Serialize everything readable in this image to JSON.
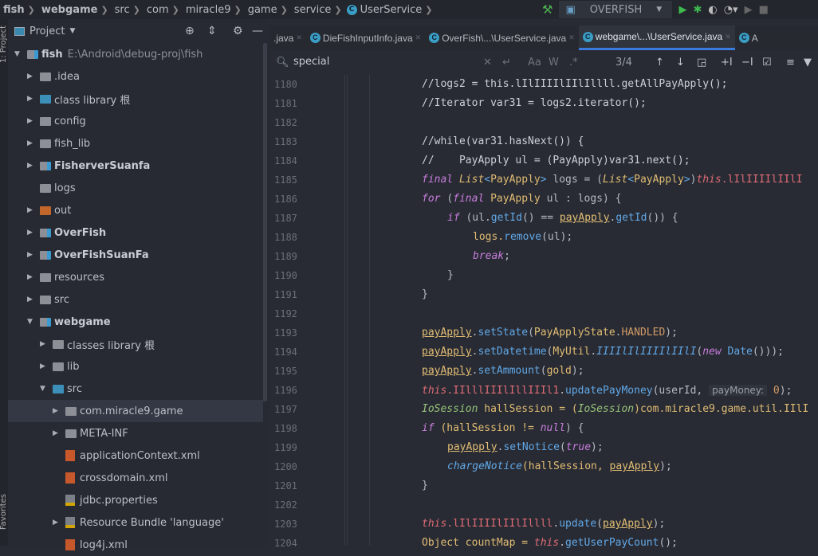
{
  "breadcrumb": [
    "fish",
    "webgame",
    "src",
    "com",
    "miracle9",
    "game",
    "service",
    "UserService"
  ],
  "run_config": "OVERFISH",
  "project": {
    "title": "Project",
    "tool_window_label": "1: Project",
    "favorites_label": "Favorites",
    "tree": [
      {
        "label": "fish",
        "hint": "E:\\Android\\debug-proj\\fish",
        "bold": true,
        "level": 0,
        "arrow": "down",
        "icon": "module"
      },
      {
        "label": ".idea",
        "level": 1,
        "arrow": "right",
        "icon": "folder"
      },
      {
        "label": "class library 根",
        "level": 1,
        "arrow": "right",
        "icon": "folder-blue"
      },
      {
        "label": "config",
        "level": 1,
        "arrow": "right",
        "icon": "folder"
      },
      {
        "label": "fish_lib",
        "level": 1,
        "arrow": "right",
        "icon": "folder"
      },
      {
        "label": "FisherverSuanfa",
        "bold": true,
        "level": 1,
        "arrow": "right",
        "icon": "module"
      },
      {
        "label": "logs",
        "level": 1,
        "arrow": "",
        "icon": "folder"
      },
      {
        "label": "out",
        "level": 1,
        "arrow": "right",
        "icon": "folder-orange"
      },
      {
        "label": "OverFish",
        "bold": true,
        "level": 1,
        "arrow": "right",
        "icon": "module"
      },
      {
        "label": "OverFishSuanFa",
        "bold": true,
        "level": 1,
        "arrow": "right",
        "icon": "module"
      },
      {
        "label": "resources",
        "level": 1,
        "arrow": "right",
        "icon": "folder"
      },
      {
        "label": "src",
        "level": 1,
        "arrow": "right",
        "icon": "folder"
      },
      {
        "label": "webgame",
        "bold": true,
        "level": 1,
        "arrow": "down",
        "icon": "module"
      },
      {
        "label": "classes library 根",
        "level": 2,
        "arrow": "right",
        "icon": "folder"
      },
      {
        "label": "lib",
        "level": 2,
        "arrow": "right",
        "icon": "folder"
      },
      {
        "label": "src",
        "level": 2,
        "arrow": "down",
        "icon": "folder-blue"
      },
      {
        "label": "com.miracle9.game",
        "level": 3,
        "arrow": "right",
        "icon": "package",
        "selected": true
      },
      {
        "label": "META-INF",
        "level": 3,
        "arrow": "right",
        "icon": "folder"
      },
      {
        "label": "applicationContext.xml",
        "level": 3,
        "arrow": "",
        "icon": "xml"
      },
      {
        "label": "crossdomain.xml",
        "level": 3,
        "arrow": "",
        "icon": "xml"
      },
      {
        "label": "jdbc.properties",
        "level": 3,
        "arrow": "",
        "icon": "properties"
      },
      {
        "label": "Resource Bundle 'language'",
        "level": 3,
        "arrow": "right",
        "icon": "properties"
      },
      {
        "label": "log4j.xml",
        "level": 3,
        "arrow": "",
        "icon": "xml"
      }
    ]
  },
  "tabs": [
    {
      "label": ".java",
      "active": false
    },
    {
      "label": "DieFishInputInfo.java",
      "active": false
    },
    {
      "label": "OverFish\\...\\UserService.java",
      "active": false
    },
    {
      "label": "webgame\\...\\UserService.java",
      "active": true
    },
    {
      "label": "A",
      "active": false
    }
  ],
  "search": {
    "query": "special",
    "match_count": "3/4",
    "buttons": [
      "Aa",
      "W",
      ".*"
    ]
  },
  "code": [
    {
      "n": "1180",
      "indent": 0,
      "seg": [
        [
          "//logs2 = this.lIlIIIIlIIlIllll.getAllPayApply();",
          "c"
        ]
      ]
    },
    {
      "n": "1181",
      "indent": 0,
      "seg": [
        [
          "//Iterator var31 = logs2.iterator();",
          "c"
        ]
      ]
    },
    {
      "n": "1182",
      "indent": 0,
      "seg": []
    },
    {
      "n": "1183",
      "indent": 0,
      "seg": [
        [
          "//while(var31.hasNext()) {",
          "c"
        ]
      ]
    },
    {
      "n": "1184",
      "indent": 0,
      "seg": [
        [
          "//    PayApply ul = (PayApply)var31.next();",
          "c"
        ]
      ]
    },
    {
      "n": "1185",
      "indent": 0,
      "seg": [
        [
          "final ",
          "k"
        ],
        [
          "List",
          "t i"
        ],
        [
          "<",
          "m"
        ],
        [
          "PayApply",
          "t"
        ],
        [
          "> ",
          "m"
        ],
        [
          "logs = (",
          "p"
        ],
        [
          "List",
          "t i"
        ],
        [
          "<",
          "m"
        ],
        [
          "PayApply",
          "t"
        ],
        [
          ">",
          "m"
        ],
        [
          ")",
          "p"
        ],
        [
          "this",
          "f i"
        ],
        [
          ".lIlIIIIlIIlI",
          "f"
        ]
      ]
    },
    {
      "n": "1186",
      "indent": 0,
      "seg": [
        [
          "for ",
          "k"
        ],
        [
          "(",
          "p"
        ],
        [
          "final ",
          "k"
        ],
        [
          "PayApply ",
          "t"
        ],
        [
          "ul : logs) {",
          "p"
        ]
      ]
    },
    {
      "n": "1187",
      "indent": 1,
      "seg": [
        [
          "if ",
          "k"
        ],
        [
          "(ul.",
          "p"
        ],
        [
          "getId",
          "m"
        ],
        [
          "() == ",
          "p"
        ],
        [
          "payApply",
          "u"
        ],
        [
          ".",
          "p"
        ],
        [
          "getId",
          "m"
        ],
        [
          "()) {",
          "p"
        ]
      ]
    },
    {
      "n": "1188",
      "indent": 2,
      "seg": [
        [
          "logs.",
          "t"
        ],
        [
          "remove",
          "m"
        ],
        [
          "(ul);",
          "p"
        ]
      ]
    },
    {
      "n": "1189",
      "indent": 2,
      "seg": [
        [
          "break",
          "k"
        ],
        [
          ";",
          "p"
        ]
      ]
    },
    {
      "n": "1190",
      "indent": 1,
      "seg": [
        [
          "}",
          "p"
        ]
      ]
    },
    {
      "n": "1191",
      "indent": 0,
      "seg": [
        [
          "}",
          "p"
        ]
      ]
    },
    {
      "n": "1192",
      "indent": 0,
      "seg": []
    },
    {
      "n": "1193",
      "indent": 0,
      "seg": [
        [
          "payApply",
          "u"
        ],
        [
          ".",
          "p"
        ],
        [
          "setState",
          "m"
        ],
        [
          "(",
          "p"
        ],
        [
          "PayApplyState",
          "t"
        ],
        [
          ".",
          "p"
        ],
        [
          "HANDLED",
          "n"
        ],
        [
          ");",
          "p"
        ]
      ]
    },
    {
      "n": "1194",
      "indent": 0,
      "seg": [
        [
          "payApply",
          "u"
        ],
        [
          ".",
          "p"
        ],
        [
          "setDatetime",
          "m"
        ],
        [
          "(",
          "p"
        ],
        [
          "MyUtil",
          "t"
        ],
        [
          ".",
          "p"
        ],
        [
          "IIIIlIlIIIIlIIlI",
          "m i"
        ],
        [
          "(",
          "p"
        ],
        [
          "new ",
          "k"
        ],
        [
          "Date",
          "m"
        ],
        [
          "()));",
          "p"
        ]
      ]
    },
    {
      "n": "1195",
      "indent": 0,
      "seg": [
        [
          "payApply",
          "u"
        ],
        [
          ".",
          "p"
        ],
        [
          "setAmmount",
          "m"
        ],
        [
          "(",
          "p"
        ],
        [
          "gold",
          "t"
        ],
        [
          ");",
          "p"
        ]
      ]
    },
    {
      "n": "1196",
      "indent": 0,
      "seg": [
        [
          "this",
          "f i"
        ],
        [
          ".IIlllIIIlIllIIIl1",
          "f"
        ],
        [
          ".",
          "p"
        ],
        [
          "updatePayMoney",
          "m"
        ],
        [
          "(userId, ",
          "p"
        ],
        [
          "payMoney:",
          "h"
        ],
        [
          " 0",
          "n"
        ],
        [
          ");",
          "p"
        ]
      ]
    },
    {
      "n": "1197",
      "indent": 0,
      "seg": [
        [
          "IoSession ",
          "g i"
        ],
        [
          "hallSession = (",
          "t"
        ],
        [
          "IoSession",
          "g i"
        ],
        [
          ")com.miracle9.game.util.IIlI",
          "t"
        ]
      ]
    },
    {
      "n": "1198",
      "indent": 0,
      "seg": [
        [
          "if ",
          "k"
        ],
        [
          "(hallSession != ",
          "t"
        ],
        [
          "null",
          "k"
        ],
        [
          ") {",
          "p"
        ]
      ]
    },
    {
      "n": "1199",
      "indent": 1,
      "seg": [
        [
          "payApply",
          "u"
        ],
        [
          ".",
          "p"
        ],
        [
          "setNotice",
          "m"
        ],
        [
          "(",
          "p"
        ],
        [
          "true",
          "k"
        ],
        [
          ");",
          "p"
        ]
      ]
    },
    {
      "n": "1200",
      "indent": 1,
      "seg": [
        [
          "chargeNotice",
          "m i"
        ],
        [
          "(hallSession, ",
          "t"
        ],
        [
          "payApply",
          "u"
        ],
        [
          ");",
          "p"
        ]
      ]
    },
    {
      "n": "1201",
      "indent": 0,
      "seg": [
        [
          "}",
          "p"
        ]
      ]
    },
    {
      "n": "1202",
      "indent": 0,
      "seg": []
    },
    {
      "n": "1203",
      "indent": 0,
      "seg": [
        [
          "this",
          "f i"
        ],
        [
          ".lIlIIIIlIIlIllll",
          "f"
        ],
        [
          ".",
          "p"
        ],
        [
          "update",
          "m"
        ],
        [
          "(",
          "p"
        ],
        [
          "payApply",
          "u"
        ],
        [
          ");",
          "p"
        ]
      ]
    },
    {
      "n": "1204",
      "indent": 0,
      "seg": [
        [
          "Object ",
          "t"
        ],
        [
          "countMap = ",
          "t"
        ],
        [
          "this",
          "f i"
        ],
        [
          ".",
          "p"
        ],
        [
          "getUserPayCount",
          "m"
        ],
        [
          "();",
          "p"
        ]
      ]
    }
  ]
}
